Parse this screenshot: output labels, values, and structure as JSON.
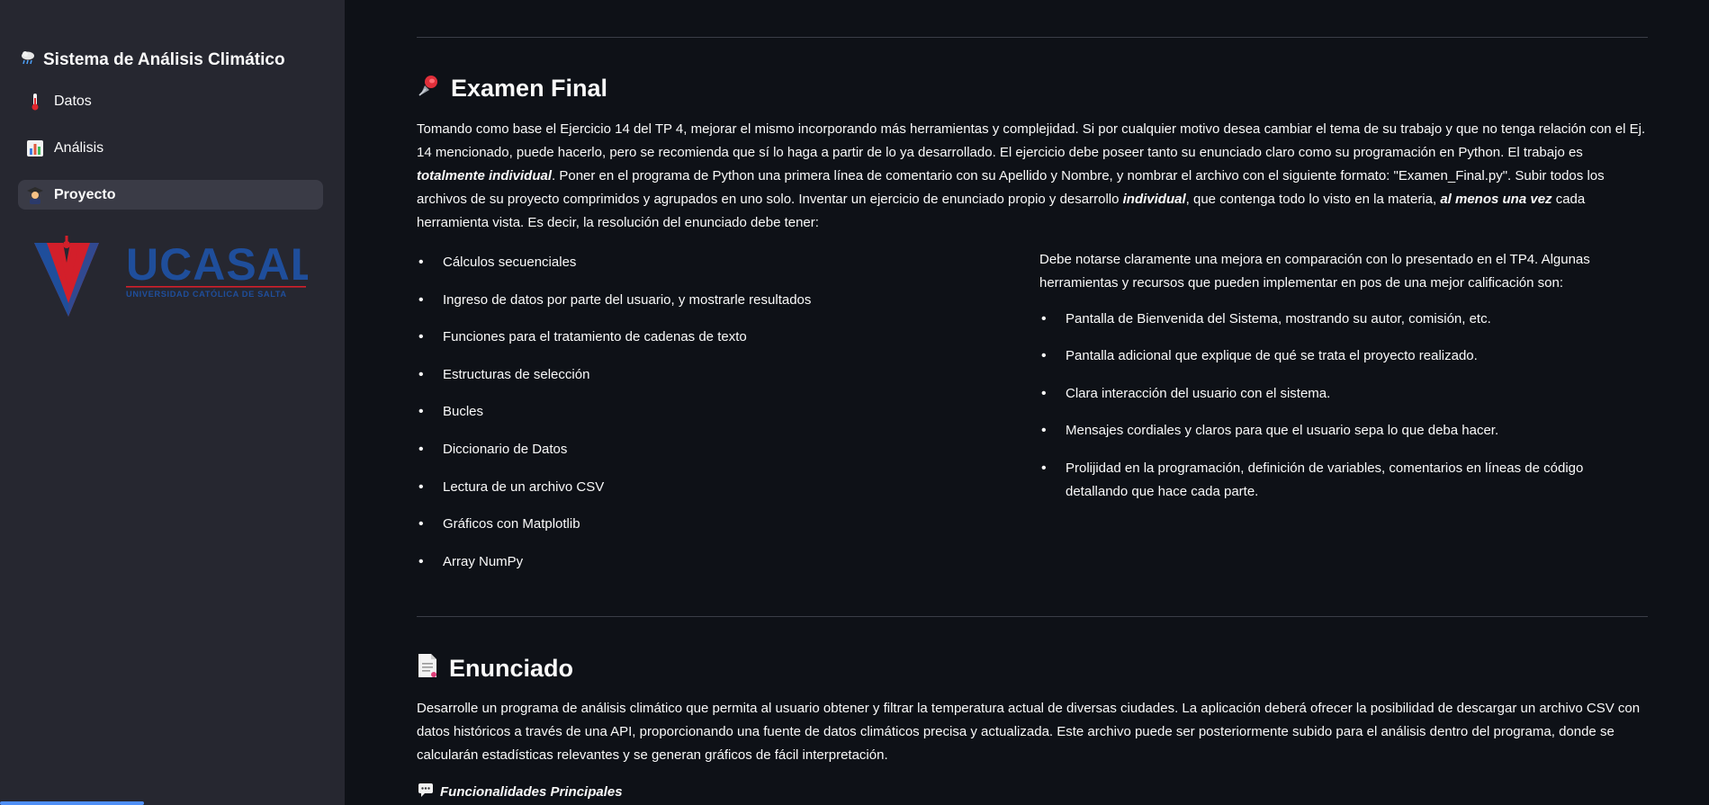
{
  "sidebar": {
    "app_title": "Sistema de Análisis Climático",
    "nav": [
      {
        "label": "Datos",
        "icon": "thermometer-icon"
      },
      {
        "label": "Análisis",
        "icon": "bar-chart-icon"
      },
      {
        "label": "Proyecto",
        "icon": "student-icon",
        "active": true
      }
    ],
    "logo": {
      "name": "UCASAL",
      "subtitle": "UNIVERSIDAD CATÓLICA DE SALTA",
      "brand_blue": "#1f4e9b",
      "brand_red": "#d31f2a"
    }
  },
  "exam": {
    "title": "Examen Final",
    "icon": "pushpin-icon",
    "paragraph": [
      {
        "t": "Tomando como base el Ejercicio 14 del TP 4, mejorar el mismo incorporando más herramientas y complejidad. Si por cualquier motivo desea cambiar el tema de su trabajo y que no tenga relación con el Ej. 14 mencionado, puede hacerlo, pero se recomienda que sí lo haga a partir de lo ya desarrollado. El ejercicio debe poseer tanto su enunciado claro como su programación en Python. El trabajo es "
      },
      {
        "t": "totalmente individual",
        "bi": true
      },
      {
        "t": ". Poner en el programa de Python una primera línea de comentario con su Apellido y Nombre, y nombrar el archivo con el siguiente formato: \"Examen_Final.py\". Subir todos los archivos de su proyecto comprimidos y agrupados en uno solo. Inventar un ejercicio de enunciado propio y desarrollo "
      },
      {
        "t": "individual",
        "bi": true
      },
      {
        "t": ", que contenga todo lo visto en la materia, "
      },
      {
        "t": "al menos una vez",
        "bi": true
      },
      {
        "t": " cada herramienta vista. Es decir, la resolución del enunciado debe tener:"
      }
    ],
    "requirements": [
      "Cálculos secuenciales",
      "Ingreso de datos por parte del usuario, y mostrarle resultados",
      "Funciones para el tratamiento de cadenas de texto",
      "Estructuras de selección",
      "Bucles",
      "Diccionario de Datos",
      "Lectura de un archivo CSV",
      "Gráficos con Matplotlib",
      "Array NumPy"
    ],
    "improvements_intro": "Debe notarse claramente una mejora en comparación con lo presentado en el TP4. Algunas herramientas y recursos que pueden implementar en pos de una mejor calificación son:",
    "improvements": [
      "Pantalla de Bienvenida del Sistema, mostrando su autor, comisión, etc.",
      "Pantalla adicional que explique de qué se trata el proyecto realizado.",
      "Clara interacción del usuario con el sistema.",
      "Mensajes cordiales y claros para que el usuario sepa lo que deba hacer.",
      "Prolijidad en la programación, definición de variables, comentarios en líneas de código detallando que hace cada parte."
    ]
  },
  "statement": {
    "title": "Enunciado",
    "icon": "page-icon",
    "paragraph": "Desarrolle un programa de análisis climático que permita al usuario obtener y filtrar la temperatura actual de diversas ciudades. La aplicación deberá ofrecer la posibilidad de descargar un archivo CSV con datos históricos a través de una API, proporcionando una fuente de datos climáticos precisa y actualizada. Este archivo puede ser posteriormente subido para el análisis dentro del programa, donde se calcularán estadísticas relevantes y se generan gráficos de fácil interpretación.",
    "features_heading": "Funcionalidades Principales",
    "features_icon": "speech-bubble-icon"
  }
}
